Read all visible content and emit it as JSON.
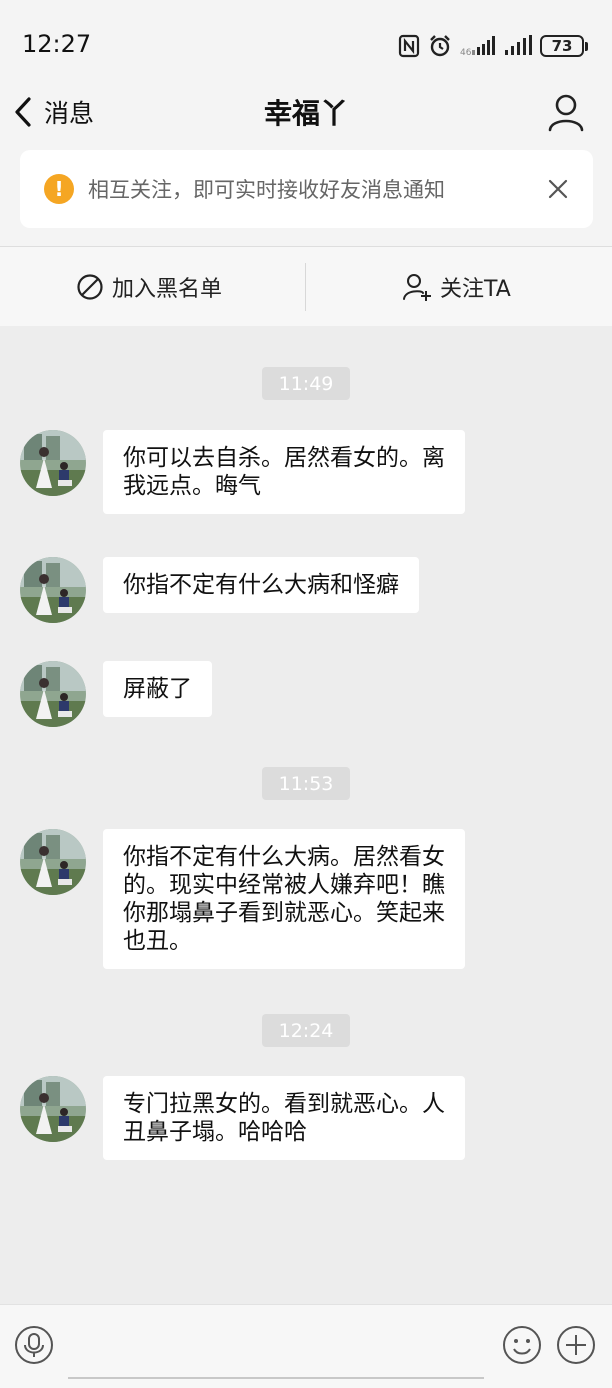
{
  "status_bar": {
    "time": "12:27",
    "battery": "73",
    "icons": [
      "nfc-icon",
      "alarm-icon",
      "signal-weak-icon",
      "signal-icon",
      "battery-icon"
    ]
  },
  "nav": {
    "back_label": "消息",
    "title": "幸福丫"
  },
  "notice": {
    "text": "相互关注，即可实时接收好友消息通知",
    "icon_char": "!",
    "accent_color": "#f5a623"
  },
  "actions": {
    "block_label": "加入黑名单",
    "follow_label": "关注TA"
  },
  "chat": {
    "timestamps": [
      "11:49",
      "11:53",
      "12:24"
    ],
    "messages": [
      {
        "sender": "other",
        "text_lines": [
          "你可以去自杀。居然看女的。离",
          "我远点。晦气"
        ]
      },
      {
        "sender": "other",
        "text_lines": [
          "你指不定有什么大病和怪癖"
        ]
      },
      {
        "sender": "other",
        "text_lines": [
          "屏蔽了"
        ]
      },
      {
        "sender": "other",
        "text_lines": [
          "你指不定有什么大病。居然看女",
          "的。现实中经常被人嫌弃吧！瞧",
          "你那塌鼻子看到就恶心。笑起来",
          "也丑。"
        ]
      },
      {
        "sender": "other",
        "text_lines": [
          "专门拉黑女的。看到就恶心。人",
          "丑鼻子塌。哈哈哈"
        ]
      }
    ]
  },
  "input": {
    "value": "",
    "placeholder": ""
  }
}
